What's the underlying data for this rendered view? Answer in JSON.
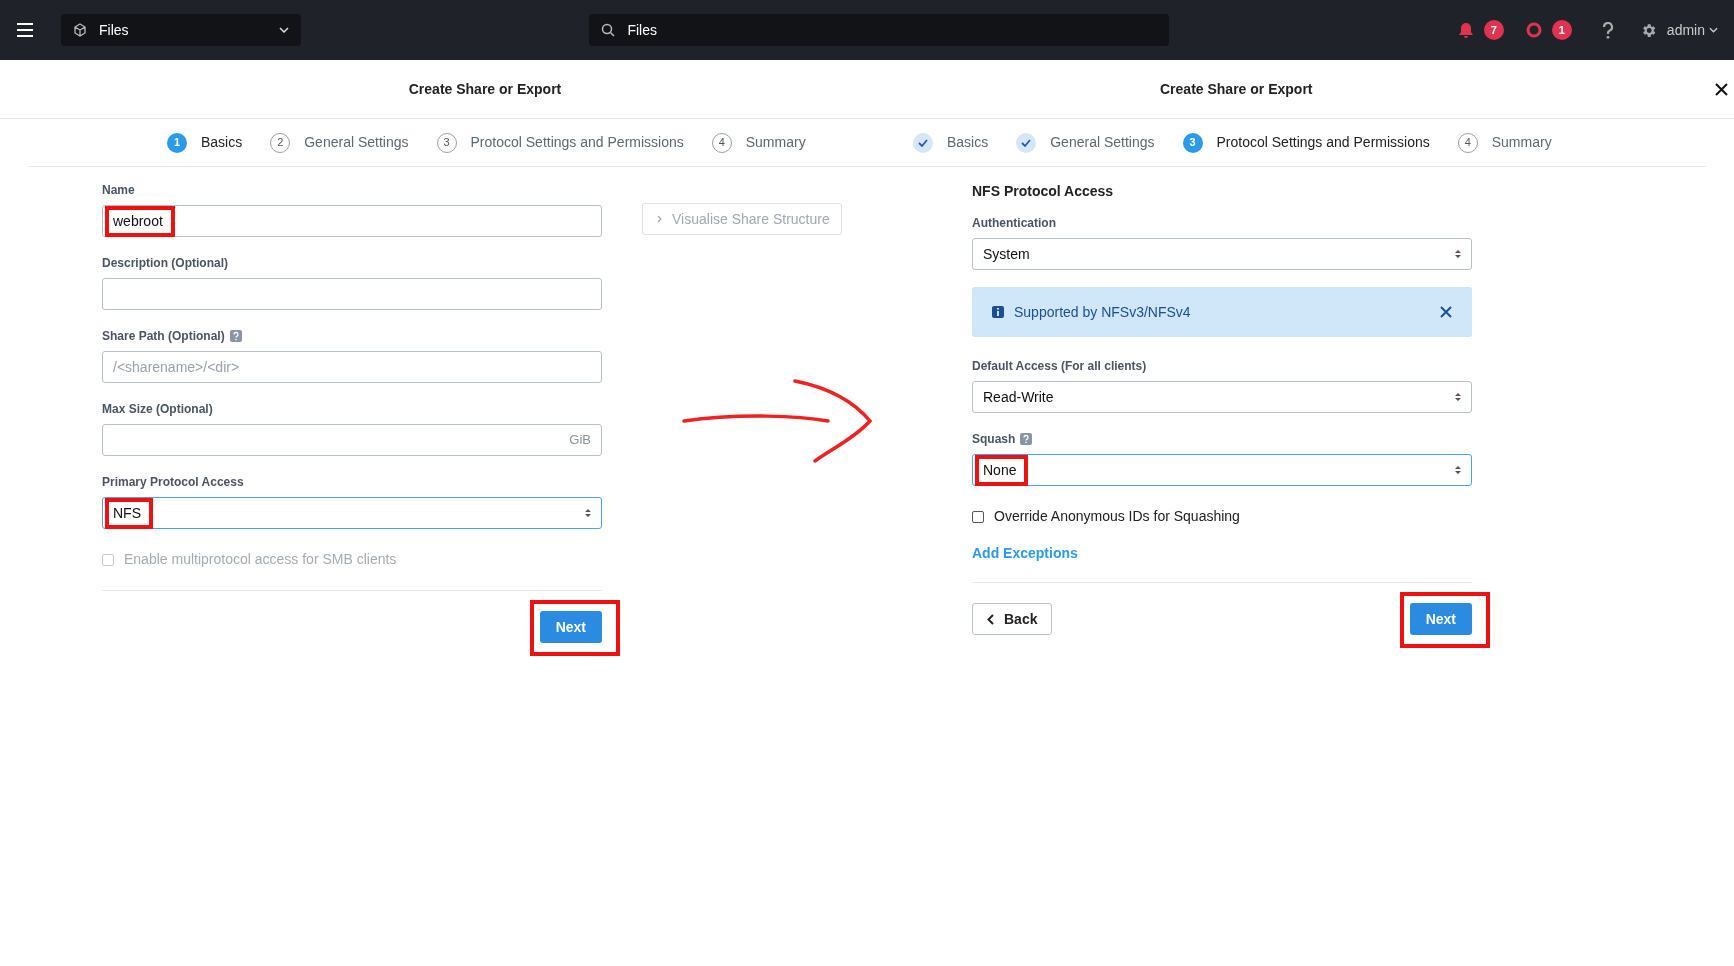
{
  "top_bar": {
    "app_selector": "Files",
    "search": "Files",
    "alert_count": "7",
    "critical_count": "1",
    "user": "admin"
  },
  "basics_panel": {
    "title": "Create Share or Export",
    "steps": [
      {
        "number": "1",
        "label": "Basics",
        "selected": true,
        "completed": false
      },
      {
        "number": "2",
        "label": "General Settings",
        "selected": false,
        "completed": false
      },
      {
        "number": "3",
        "label": "Protocol Settings and Permissions",
        "selected": false,
        "completed": false
      },
      {
        "number": "4",
        "label": "Summary",
        "selected": false,
        "completed": false
      }
    ],
    "fields": [
      {
        "kind": "text",
        "label": "Name",
        "value": "webroot",
        "highlighted": true,
        "focused": false
      },
      {
        "kind": "text",
        "label": "Description (Optional)",
        "highlighted": false,
        "focused": false
      },
      {
        "kind": "text",
        "label": "Share Path (Optional)",
        "placeholder": "/<sharename>/<dir>",
        "highlighted": false,
        "focused": false,
        "help": true
      },
      {
        "kind": "text",
        "label": "Max Size (Optional)",
        "suffix": "GiB",
        "highlighted": false,
        "focused": false
      },
      {
        "kind": "select",
        "label": "Primary Protocol Access",
        "value": "NFS",
        "highlighted": true,
        "focused": true
      },
      {
        "kind": "checkbox",
        "label": "Enable multiprotocol access for SMB clients",
        "checked": false,
        "disabled": true
      }
    ],
    "visualise_button": "Visualise Share Structure",
    "next_button": {
      "label": "Next",
      "highlighted": true
    }
  },
  "protocol_panel": {
    "title": "Create Share or Export",
    "steps": [
      {
        "label": "Basics",
        "selected": false,
        "completed": true
      },
      {
        "label": "General Settings",
        "selected": false,
        "completed": true
      },
      {
        "number": "3",
        "label": "Protocol Settings and Permissions",
        "selected": true,
        "completed": false
      },
      {
        "number": "4",
        "label": "Summary",
        "selected": false,
        "completed": false
      }
    ],
    "section_title": "NFS Protocol Access",
    "fields": [
      {
        "kind": "select",
        "label": "Authentication",
        "value": "System",
        "highlighted": false,
        "focused": false
      },
      {
        "kind": "info",
        "text": "Supported by NFSv3/NFSv4"
      },
      {
        "kind": "select",
        "label": "Default Access (For all clients)",
        "value": "Read-Write",
        "highlighted": false,
        "focused": false
      },
      {
        "kind": "select",
        "label": "Squash",
        "value": "None",
        "highlighted": true,
        "focused": true,
        "help": true
      },
      {
        "kind": "checkbox",
        "label": "Override Anonymous IDs for Squashing",
        "checked": false,
        "disabled": false
      },
      {
        "kind": "link",
        "label": "Add Exceptions"
      }
    ],
    "back_button": "Back",
    "next_button": {
      "label": "Next",
      "highlighted": true
    }
  }
}
